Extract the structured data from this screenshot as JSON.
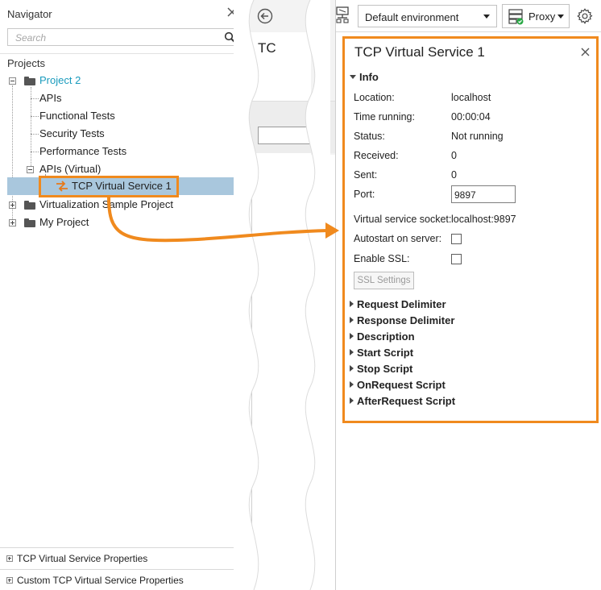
{
  "navigator": {
    "title": "Navigator",
    "search_placeholder": "Search",
    "projects_label": "Projects",
    "tree": {
      "project2": "Project 2",
      "apis": "APIs",
      "functional_tests": "Functional Tests",
      "security_tests": "Security Tests",
      "performance_tests": "Performance Tests",
      "apis_virtual": "APIs (Virtual)",
      "tcp_service": "TCP Virtual Service 1",
      "virtualization_sample": "Virtualization Sample Project",
      "my_project": "My Project"
    },
    "bottom_panels": [
      "TCP Virtual Service Properties",
      "Custom TCP Virtual Service Properties"
    ]
  },
  "middle": {
    "title_fragment": "TC"
  },
  "toolbar": {
    "environment": "Default environment",
    "proxy_label": "Proxy"
  },
  "details": {
    "title": "TCP Virtual Service 1",
    "info_section": "Info",
    "properties": {
      "location_label": "Location:",
      "location_value": "localhost",
      "time_running_label": "Time running:",
      "time_running_value": "00:00:04",
      "status_label": "Status:",
      "status_value": "Not running",
      "received_label": "Received:",
      "received_value": "0",
      "sent_label": "Sent:",
      "sent_value": "0",
      "port_label": "Port:",
      "port_value": "9897",
      "socket_label": "Virtual service socket:",
      "socket_value": "localhost:9897",
      "autostart_label": "Autostart on server:",
      "enable_ssl_label": "Enable SSL:"
    },
    "ssl_settings_button": "SSL Settings",
    "collapsed_sections": [
      "Request Delimiter",
      "Response Delimiter",
      "Description",
      "Start Script",
      "Stop Script",
      "OnRequest Script",
      "AfterRequest Script"
    ]
  },
  "colors": {
    "highlight": "#f08a1e",
    "selection": "#a9c7dd",
    "project_link": "#1a9bbd"
  }
}
